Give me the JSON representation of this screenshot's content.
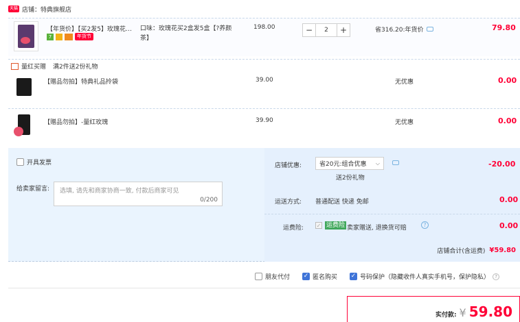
{
  "shop": {
    "badge": "天猫",
    "label": "店铺：特典旗舰店"
  },
  "main_item": {
    "title": "【年货价】【买2发5】玫瑰花…",
    "tag_year": "年货节",
    "attrs": "口味：玫瑰花买2盒发5盒【?养颜茶】",
    "price": "198.00",
    "qty": "2",
    "minus": "−",
    "plus": "+",
    "saved": "省316.20:年货价",
    "total": "79.80"
  },
  "promo": {
    "label": "量红买赠",
    "desc": "满2件送2份礼物"
  },
  "gifts": [
    {
      "title": "【赠品勿拍】特典礼品拎袋",
      "price": "39.00",
      "discount": "无优惠",
      "total": "0.00"
    },
    {
      "title": "【赠品勿拍】-量红玫瑰",
      "price": "39.90",
      "discount": "无优惠",
      "total": "0.00"
    }
  ],
  "invoice": {
    "label": "开具发票"
  },
  "message": {
    "label": "给卖家留言:",
    "placeholder": "选填, 请先和商家协商一致, 付款后商家可见",
    "count": "0/200"
  },
  "shop_discount": {
    "label": "店铺优惠:",
    "selected": "省20元:组合优惠",
    "gift_note": "送2份礼物",
    "amount": "-20.00"
  },
  "shipping": {
    "label": "运送方式:",
    "value": "普通配送 快递 免邮",
    "amount": "0.00"
  },
  "insurance": {
    "label": "运费险:",
    "badge": "运费险",
    "text": "卖家赠送, 退换货可赔",
    "amount": "0.00"
  },
  "subtotal": {
    "label": "店铺合计(含运费)",
    "amount": "¥59.80"
  },
  "options": [
    {
      "label": "朋友代付",
      "checked": false
    },
    {
      "label": "匿名购买",
      "checked": true
    },
    {
      "label": "号码保护（隐藏收件人真实手机号，保护隐私）",
      "checked": true
    }
  ],
  "pay": {
    "label": "实付款:",
    "currency": "¥",
    "amount": "59.80"
  },
  "colors": {
    "accent": "#ff0036",
    "panel": "#eaf4fe",
    "check": "#3f74d8"
  }
}
